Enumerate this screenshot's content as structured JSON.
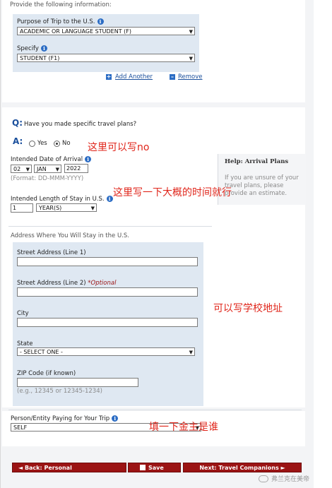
{
  "header": {
    "provide_text": "Provide the following information:"
  },
  "purpose": {
    "label": "Purpose of Trip to the U.S.",
    "value": "ACADEMIC OR LANGUAGE STUDENT (F)",
    "specify_label": "Specify",
    "specify_value": "STUDENT (F1)",
    "add_another": "Add Another",
    "remove": "Remove"
  },
  "travel_plans": {
    "q_marker": "Q:",
    "question": "Have you made specific travel plans?",
    "a_marker": "A:",
    "yes_label": "Yes",
    "no_label": "No",
    "selected": "No"
  },
  "arrival": {
    "label": "Intended Date of Arrival",
    "day": "02",
    "month": "JAN",
    "year": "2022",
    "format_hint": "(Format: DD-MMM-YYYY)"
  },
  "stay": {
    "label": "Intended Length of Stay in U.S.",
    "number": "1",
    "unit": "YEAR(S)"
  },
  "help": {
    "title": "Help: Arrival Plans",
    "text_line1": "If you are unsure of your",
    "text_line2": "travel plans, please",
    "text_line3": "provide an estimate."
  },
  "address": {
    "section_label": "Address Where You Will Stay in the U.S.",
    "street1_label": "Street Address (Line 1)",
    "street1_value": "",
    "street2_label": "Street Address (Line 2)",
    "street2_optional": "*Optional",
    "street2_value": "",
    "city_label": "City",
    "city_value": "",
    "state_label": "State",
    "state_value": "- SELECT ONE -",
    "zip_label": "ZIP Code (if known)",
    "zip_value": "",
    "zip_hint": "(e.g., 12345 or 12345-1234)"
  },
  "payer": {
    "label": "Person/Entity Paying for Your Trip",
    "value": "SELF"
  },
  "annotations": {
    "note1": "这里可以写no",
    "note2": "这里写一下大概的时间就行",
    "note3": "可以写学校地址",
    "note4": "填一下金主是谁"
  },
  "nav": {
    "back": "◄ Back: Personal",
    "save": "Save",
    "next": "Next: Travel Companions ►"
  },
  "watermark": {
    "text": "弗兰克在美帝"
  },
  "colors": {
    "accent_red": "#9b1414",
    "annotation_red": "#e0261b",
    "link_blue": "#1a4f9c",
    "panel_blue": "#dfe8f2"
  }
}
